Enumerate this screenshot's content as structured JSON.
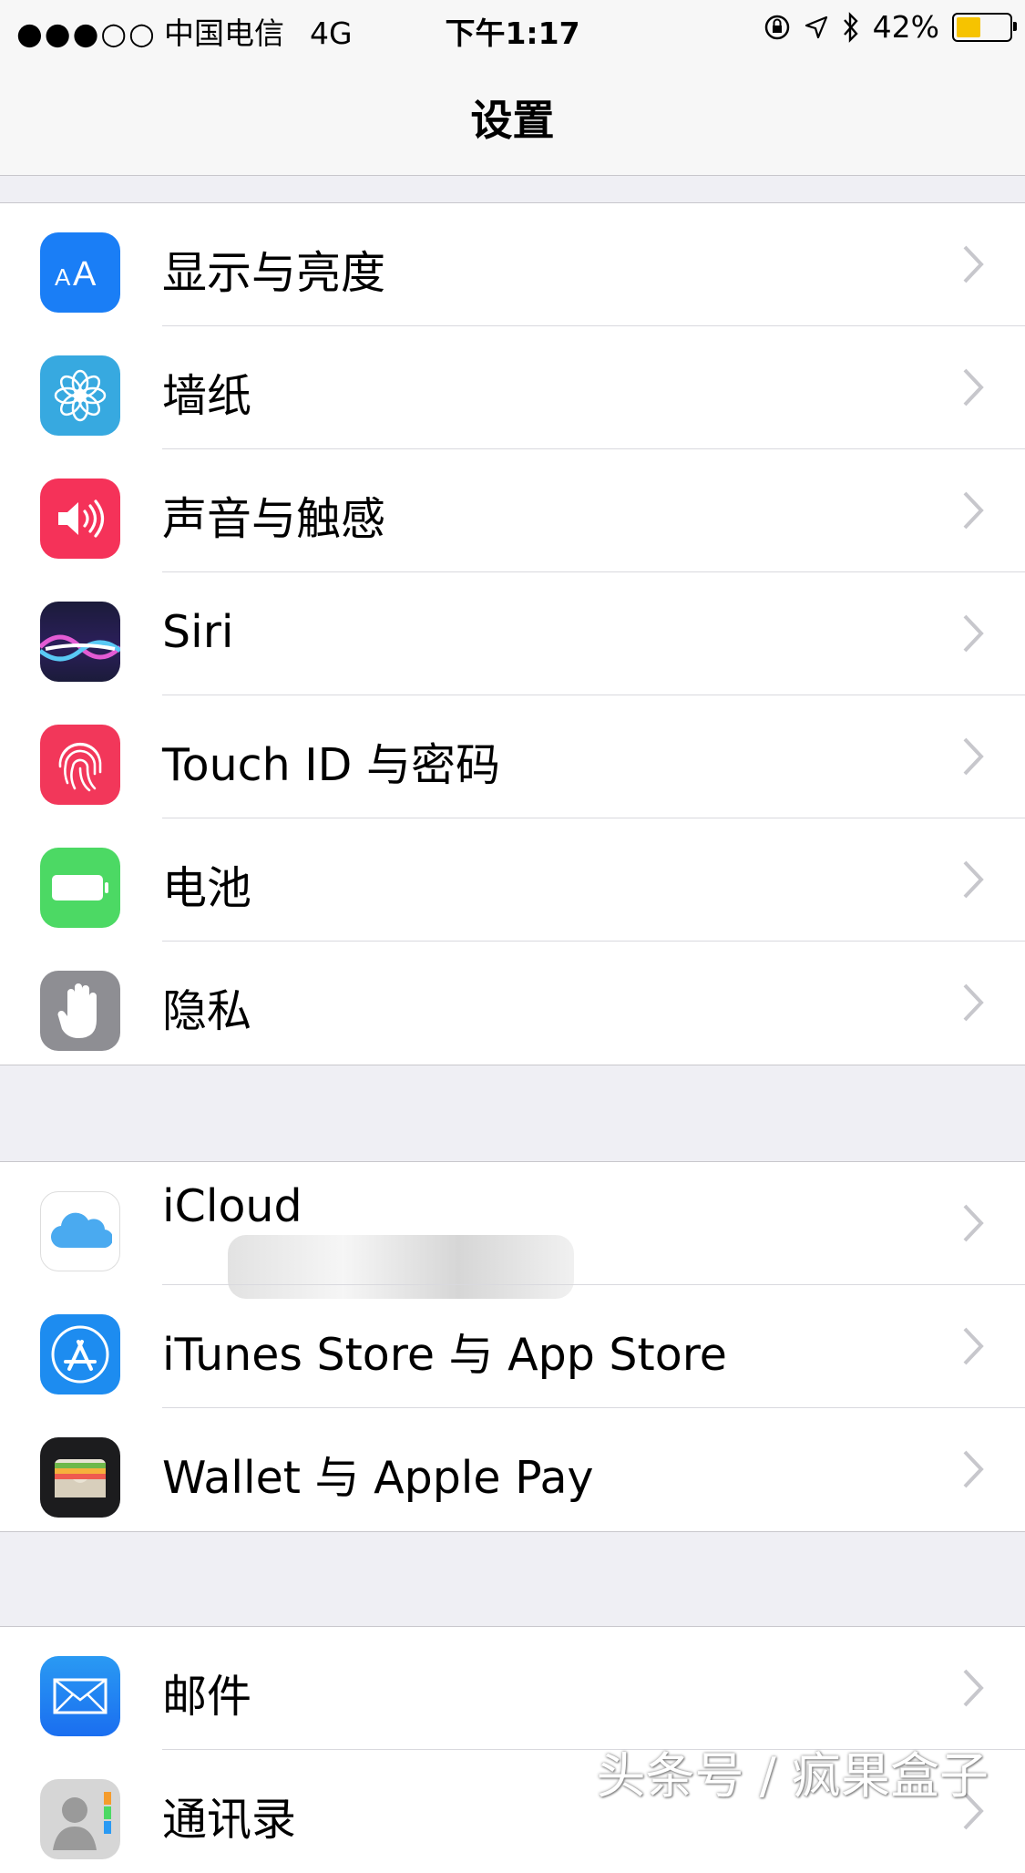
{
  "status_bar": {
    "signal": "●●●○○",
    "carrier": "中国电信",
    "network": "4G",
    "time": "下午1:17",
    "battery_percent": "42%",
    "battery_level": 0.42,
    "battery_color": "#f6c300"
  },
  "nav": {
    "title": "设置"
  },
  "groups": [
    {
      "rows": [
        {
          "label": "显示与亮度",
          "icon": "display-brightness-icon",
          "color": "#1a7ef6"
        },
        {
          "label": "墙纸",
          "icon": "wallpaper-flower-icon",
          "color": "#37a9e0"
        },
        {
          "label": "声音与触感",
          "icon": "speaker-icon",
          "color": "#f53259"
        },
        {
          "label": "Siri",
          "icon": "siri-icon",
          "color": "#1b1b3a"
        },
        {
          "label": "Touch ID 与密码",
          "icon": "fingerprint-icon",
          "color": "#f2375a"
        },
        {
          "label": "电池",
          "icon": "battery-icon",
          "color": "#4cd964"
        },
        {
          "label": "隐私",
          "icon": "hand-icon",
          "color": "#8e8e93"
        }
      ]
    },
    {
      "rows": [
        {
          "label": "iCloud",
          "icon": "cloud-icon",
          "color": "#ffffff"
        },
        {
          "label": "iTunes Store 与 App Store",
          "icon": "app-store-icon",
          "color": "#1d8cf0"
        },
        {
          "label": "Wallet 与 Apple Pay",
          "icon": "wallet-icon",
          "color": "#1c1c1e"
        }
      ]
    },
    {
      "rows": [
        {
          "label": "邮件",
          "icon": "mail-icon",
          "color": "#2a9af3"
        },
        {
          "label": "通讯录",
          "icon": "contacts-icon",
          "color": "#cfcfcf"
        }
      ]
    }
  ],
  "watermark": "头条号 / 疯果盒子"
}
